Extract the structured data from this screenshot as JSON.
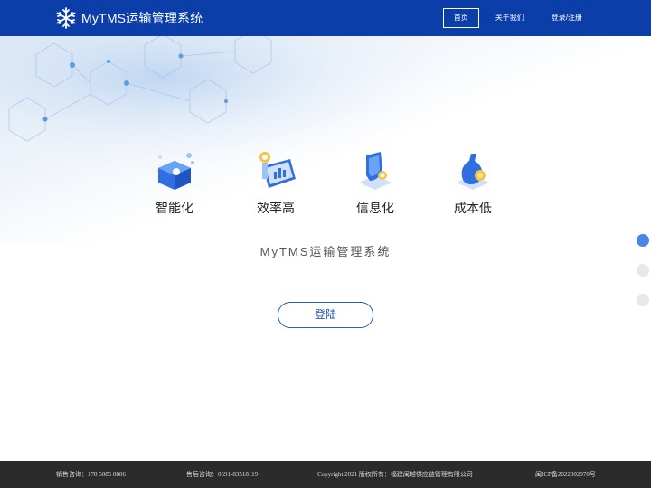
{
  "header": {
    "logo_text": "MyTMS运输管理系统",
    "nav": [
      {
        "label": "首页",
        "active": true
      },
      {
        "label": "关于我们",
        "active": false
      },
      {
        "label": "登录/注册",
        "active": false
      }
    ]
  },
  "features": [
    {
      "label": "智能化",
      "icon": "smart-box-icon"
    },
    {
      "label": "效率高",
      "icon": "monitor-chart-icon"
    },
    {
      "label": "信息化",
      "icon": "shield-icon"
    },
    {
      "label": "成本低",
      "icon": "money-bag-icon"
    }
  ],
  "subtitle": "MyTMS运输管理系统",
  "login_button": "登陆",
  "side_dots": {
    "count": 3,
    "active_index": 0
  },
  "footer": {
    "sales": "销售咨询：178 5085 8886",
    "after_sales": "售后咨询：0591-83518119",
    "copyright": "Copyright  2021 版权所有：福建闽越供应链管理有限公司",
    "icp": "闽ICP备2022002970号"
  },
  "colors": {
    "header_bg": "#0b3ea8",
    "accent": "#4a86e8",
    "button_text": "#1f4fa8",
    "footer_bg": "#2b2b2b"
  }
}
